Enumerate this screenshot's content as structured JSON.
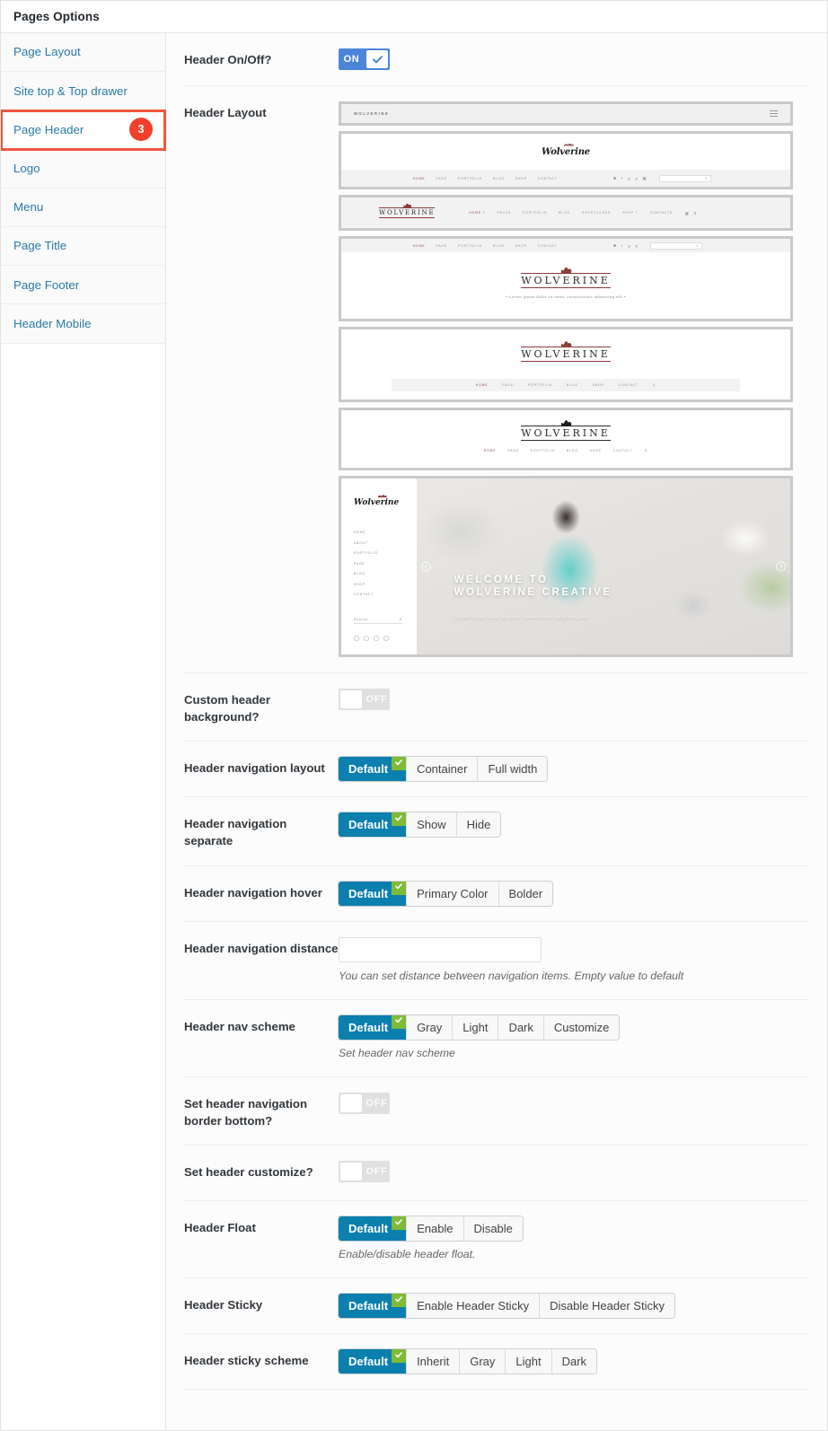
{
  "window": {
    "title": "Pages Options"
  },
  "sidebar": {
    "items": [
      {
        "label": "Page Layout",
        "badge": null,
        "active": false
      },
      {
        "label": "Site top & Top drawer",
        "badge": null,
        "active": false
      },
      {
        "label": "Page Header",
        "badge": "3",
        "active": true
      },
      {
        "label": "Logo",
        "badge": null,
        "active": false
      },
      {
        "label": "Menu",
        "badge": null,
        "active": false
      },
      {
        "label": "Page Title",
        "badge": null,
        "active": false
      },
      {
        "label": "Page Footer",
        "badge": null,
        "active": false
      },
      {
        "label": "Header Mobile",
        "badge": null,
        "active": false
      }
    ]
  },
  "colors": {
    "accent_blue": "#0b7fae",
    "toggle_on_blue": "#4a86d8",
    "check_green": "#7fba38",
    "badge_red": "#f4402a",
    "highlight_red": "#f0563f",
    "link_blue": "#2a7aa8"
  },
  "fields": {
    "header_onoff": {
      "label": "Header On/Off?",
      "state": "ON"
    },
    "header_layout": {
      "label": "Header Layout"
    },
    "custom_header_background": {
      "label": "Custom header background?",
      "state": "OFF"
    },
    "header_navigation_layout": {
      "label": "Header navigation layout",
      "options": [
        "Default",
        "Container",
        "Full width"
      ],
      "selected": "Default"
    },
    "header_navigation_separate": {
      "label": "Header navigation separate",
      "options": [
        "Default",
        "Show",
        "Hide"
      ],
      "selected": "Default"
    },
    "header_navigation_hover": {
      "label": "Header navigation hover",
      "options": [
        "Default",
        "Primary Color",
        "Bolder"
      ],
      "selected": "Default"
    },
    "header_navigation_distance": {
      "label": "Header navigation distance",
      "value": "",
      "placeholder": "",
      "description": "You can set distance between navigation items. Empty value to default"
    },
    "header_nav_scheme": {
      "label": "Header nav scheme",
      "options": [
        "Default",
        "Gray",
        "Light",
        "Dark",
        "Customize"
      ],
      "selected": "Default",
      "description": "Set header nav scheme"
    },
    "header_nav_border_bottom": {
      "label": "Set header navigation border bottom?",
      "state": "OFF"
    },
    "set_header_customize": {
      "label": "Set header customize?",
      "state": "OFF"
    },
    "header_float": {
      "label": "Header Float",
      "options": [
        "Default",
        "Enable",
        "Disable"
      ],
      "selected": "Default",
      "description": "Enable/disable header float."
    },
    "header_sticky": {
      "label": "Header Sticky",
      "options": [
        "Default",
        "Enable Header Sticky",
        "Disable Header Sticky"
      ],
      "selected": "Default"
    },
    "header_sticky_scheme": {
      "label": "Header sticky scheme",
      "options": [
        "Default",
        "Inherit",
        "Gray",
        "Light",
        "Dark"
      ],
      "selected": "Default"
    }
  },
  "previews": {
    "brand_caps": "WOLVERINE",
    "brand_script": "Wolverine",
    "nav_short": [
      "HOME",
      "PAGE",
      "PORTFOLIO",
      "BLOG",
      "SHOP",
      "CONTACT"
    ],
    "nav_long": [
      "HOME +",
      "PAGES",
      "PORTFOLIO",
      "BLOG",
      "SHORTCODES",
      "SHOP +",
      "CONTACTS"
    ],
    "side_menu": [
      "HOME",
      "ABOUT",
      "PORTFOLIO",
      "PAGE",
      "BLOG",
      "SHOP",
      "CONTACT"
    ],
    "tagline": "• Lorem ipsum dolor sit amet, consectetuer adipiscing elit •",
    "hero_title_line1": "WELCOME TO",
    "hero_title_line2": "WOLVERINE CREATIVE",
    "hero_subtitle": "Lorem ipsum dolor sit amet, consectetuer adipiscing elit",
    "search_placeholder": "Search"
  }
}
